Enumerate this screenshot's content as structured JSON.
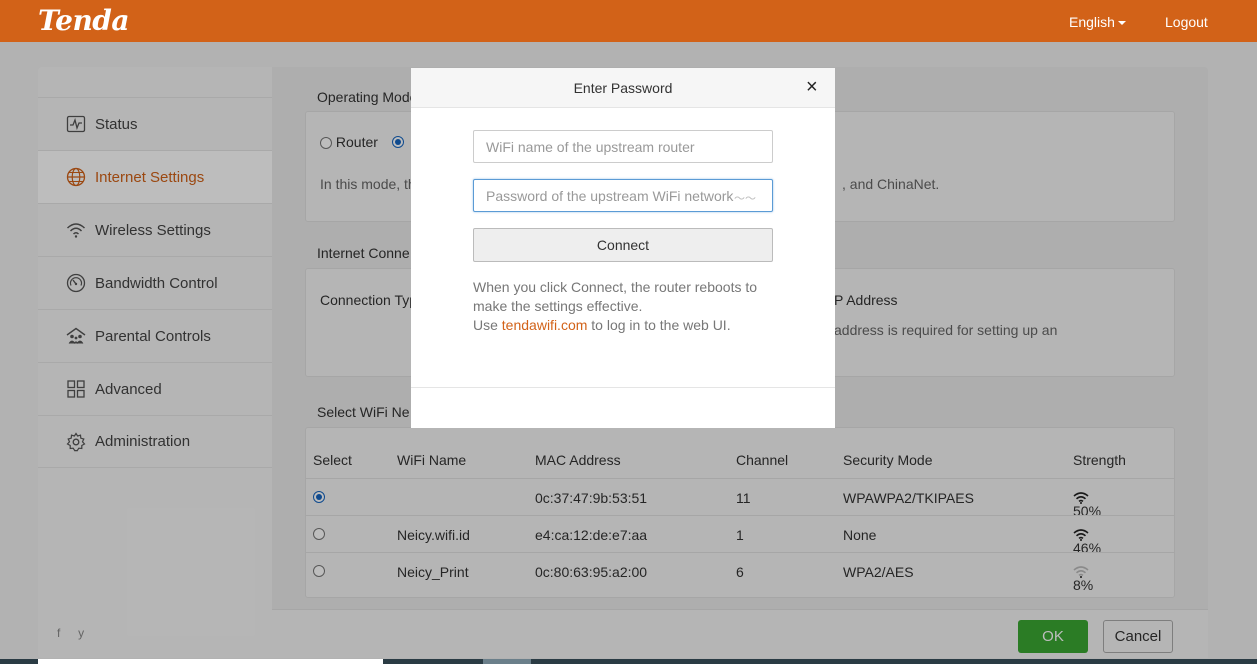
{
  "header": {
    "logo": "Tenda",
    "language": "English",
    "logout": "Logout"
  },
  "sidebar": {
    "items": [
      {
        "label": "Status",
        "icon": "status-icon"
      },
      {
        "label": "Internet Settings",
        "icon": "globe-icon",
        "active": true
      },
      {
        "label": "Wireless Settings",
        "icon": "wifi-icon"
      },
      {
        "label": "Bandwidth Control",
        "icon": "gauge-icon"
      },
      {
        "label": "Parental Controls",
        "icon": "family-icon"
      },
      {
        "label": "Advanced",
        "icon": "grid-icon"
      },
      {
        "label": "Administration",
        "icon": "gear-icon"
      }
    ],
    "social": "f  y"
  },
  "main": {
    "operating_mode": {
      "title": "Operating Mode",
      "router_label": "Router",
      "description_start": "In this mode, th",
      "description_end": ", and ChinaNet."
    },
    "internet_connection": {
      "title": "Internet Conne",
      "connection_type_label": "Connection Typ",
      "ip_address_label": "P Address",
      "ip_note": "address is required for setting up an"
    },
    "wifi_networks": {
      "title": "Select WiFi Ne",
      "columns": [
        "Select",
        "WiFi Name",
        "MAC Address",
        "Channel",
        "Security Mode",
        "Strength"
      ],
      "rows": [
        {
          "selected": true,
          "name": "",
          "mac": "0c:37:47:9b:53:51",
          "channel": "11",
          "security": "WPAWPA2/TKIPAES",
          "strength": "50%"
        },
        {
          "selected": false,
          "name": "Neicy.wifi.id",
          "mac": "e4:ca:12:de:e7:aa",
          "channel": "1",
          "security": "None",
          "strength": "46%"
        },
        {
          "selected": false,
          "name": "Neicy_Print",
          "mac": "0c:80:63:95:a2:00",
          "channel": "6",
          "security": "WPA2/AES",
          "strength": "8%"
        }
      ]
    }
  },
  "footer": {
    "ok": "OK",
    "cancel": "Cancel"
  },
  "modal": {
    "title": "Enter Password",
    "close": "×",
    "wifi_name_placeholder": "WiFi name of the upstream router",
    "password_placeholder": "Password of the upstream WiFi network",
    "connect": "Connect",
    "note_line1": "When you click Connect, the router reboots to make the settings effective.",
    "note_use": "Use ",
    "note_link": "tendawifi.com",
    "note_end": " to log in to the web UI."
  },
  "colors": {
    "brand": "#d26218",
    "ok_green": "#3aa832",
    "radio_blue": "#1565c0"
  }
}
